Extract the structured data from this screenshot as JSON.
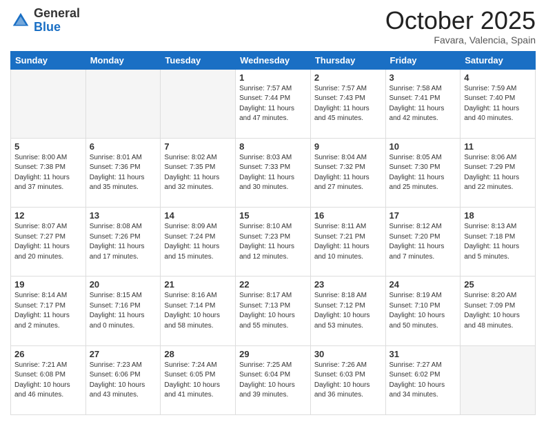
{
  "header": {
    "logo_general": "General",
    "logo_blue": "Blue",
    "month_title": "October 2025",
    "location": "Favara, Valencia, Spain"
  },
  "days_of_week": [
    "Sunday",
    "Monday",
    "Tuesday",
    "Wednesday",
    "Thursday",
    "Friday",
    "Saturday"
  ],
  "weeks": [
    [
      {
        "day": "",
        "info": ""
      },
      {
        "day": "",
        "info": ""
      },
      {
        "day": "",
        "info": ""
      },
      {
        "day": "1",
        "info": "Sunrise: 7:57 AM\nSunset: 7:44 PM\nDaylight: 11 hours\nand 47 minutes."
      },
      {
        "day": "2",
        "info": "Sunrise: 7:57 AM\nSunset: 7:43 PM\nDaylight: 11 hours\nand 45 minutes."
      },
      {
        "day": "3",
        "info": "Sunrise: 7:58 AM\nSunset: 7:41 PM\nDaylight: 11 hours\nand 42 minutes."
      },
      {
        "day": "4",
        "info": "Sunrise: 7:59 AM\nSunset: 7:40 PM\nDaylight: 11 hours\nand 40 minutes."
      }
    ],
    [
      {
        "day": "5",
        "info": "Sunrise: 8:00 AM\nSunset: 7:38 PM\nDaylight: 11 hours\nand 37 minutes."
      },
      {
        "day": "6",
        "info": "Sunrise: 8:01 AM\nSunset: 7:36 PM\nDaylight: 11 hours\nand 35 minutes."
      },
      {
        "day": "7",
        "info": "Sunrise: 8:02 AM\nSunset: 7:35 PM\nDaylight: 11 hours\nand 32 minutes."
      },
      {
        "day": "8",
        "info": "Sunrise: 8:03 AM\nSunset: 7:33 PM\nDaylight: 11 hours\nand 30 minutes."
      },
      {
        "day": "9",
        "info": "Sunrise: 8:04 AM\nSunset: 7:32 PM\nDaylight: 11 hours\nand 27 minutes."
      },
      {
        "day": "10",
        "info": "Sunrise: 8:05 AM\nSunset: 7:30 PM\nDaylight: 11 hours\nand 25 minutes."
      },
      {
        "day": "11",
        "info": "Sunrise: 8:06 AM\nSunset: 7:29 PM\nDaylight: 11 hours\nand 22 minutes."
      }
    ],
    [
      {
        "day": "12",
        "info": "Sunrise: 8:07 AM\nSunset: 7:27 PM\nDaylight: 11 hours\nand 20 minutes."
      },
      {
        "day": "13",
        "info": "Sunrise: 8:08 AM\nSunset: 7:26 PM\nDaylight: 11 hours\nand 17 minutes."
      },
      {
        "day": "14",
        "info": "Sunrise: 8:09 AM\nSunset: 7:24 PM\nDaylight: 11 hours\nand 15 minutes."
      },
      {
        "day": "15",
        "info": "Sunrise: 8:10 AM\nSunset: 7:23 PM\nDaylight: 11 hours\nand 12 minutes."
      },
      {
        "day": "16",
        "info": "Sunrise: 8:11 AM\nSunset: 7:21 PM\nDaylight: 11 hours\nand 10 minutes."
      },
      {
        "day": "17",
        "info": "Sunrise: 8:12 AM\nSunset: 7:20 PM\nDaylight: 11 hours\nand 7 minutes."
      },
      {
        "day": "18",
        "info": "Sunrise: 8:13 AM\nSunset: 7:18 PM\nDaylight: 11 hours\nand 5 minutes."
      }
    ],
    [
      {
        "day": "19",
        "info": "Sunrise: 8:14 AM\nSunset: 7:17 PM\nDaylight: 11 hours\nand 2 minutes."
      },
      {
        "day": "20",
        "info": "Sunrise: 8:15 AM\nSunset: 7:16 PM\nDaylight: 11 hours\nand 0 minutes."
      },
      {
        "day": "21",
        "info": "Sunrise: 8:16 AM\nSunset: 7:14 PM\nDaylight: 10 hours\nand 58 minutes."
      },
      {
        "day": "22",
        "info": "Sunrise: 8:17 AM\nSunset: 7:13 PM\nDaylight: 10 hours\nand 55 minutes."
      },
      {
        "day": "23",
        "info": "Sunrise: 8:18 AM\nSunset: 7:12 PM\nDaylight: 10 hours\nand 53 minutes."
      },
      {
        "day": "24",
        "info": "Sunrise: 8:19 AM\nSunset: 7:10 PM\nDaylight: 10 hours\nand 50 minutes."
      },
      {
        "day": "25",
        "info": "Sunrise: 8:20 AM\nSunset: 7:09 PM\nDaylight: 10 hours\nand 48 minutes."
      }
    ],
    [
      {
        "day": "26",
        "info": "Sunrise: 7:21 AM\nSunset: 6:08 PM\nDaylight: 10 hours\nand 46 minutes."
      },
      {
        "day": "27",
        "info": "Sunrise: 7:23 AM\nSunset: 6:06 PM\nDaylight: 10 hours\nand 43 minutes."
      },
      {
        "day": "28",
        "info": "Sunrise: 7:24 AM\nSunset: 6:05 PM\nDaylight: 10 hours\nand 41 minutes."
      },
      {
        "day": "29",
        "info": "Sunrise: 7:25 AM\nSunset: 6:04 PM\nDaylight: 10 hours\nand 39 minutes."
      },
      {
        "day": "30",
        "info": "Sunrise: 7:26 AM\nSunset: 6:03 PM\nDaylight: 10 hours\nand 36 minutes."
      },
      {
        "day": "31",
        "info": "Sunrise: 7:27 AM\nSunset: 6:02 PM\nDaylight: 10 hours\nand 34 minutes."
      },
      {
        "day": "",
        "info": ""
      }
    ]
  ]
}
